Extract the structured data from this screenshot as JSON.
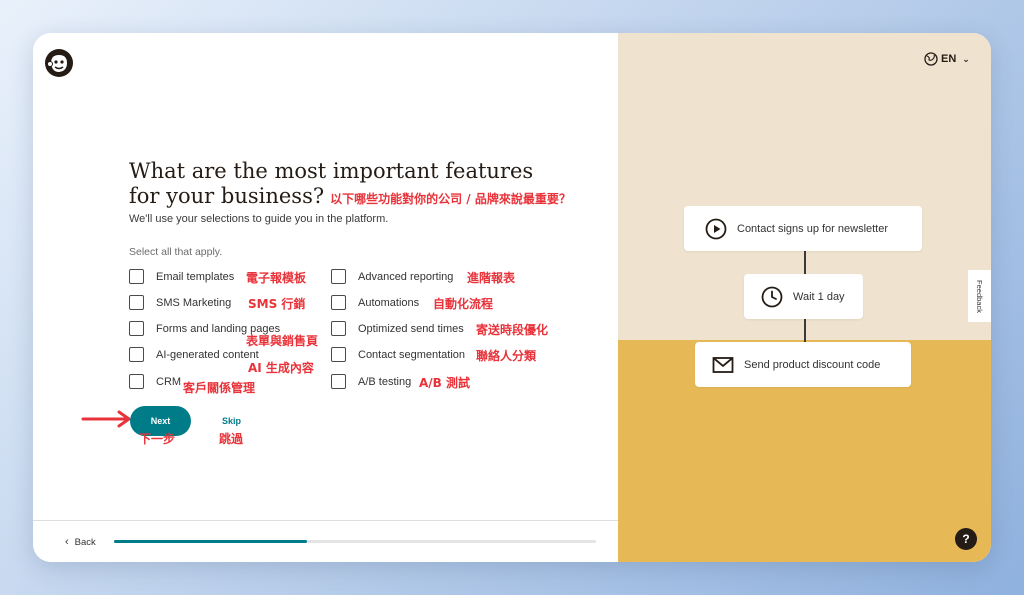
{
  "header": {
    "language": "EN"
  },
  "main": {
    "title_line1": "What are the most important features",
    "title_line2": "for your business?",
    "title_annotation": "以下哪些功能對你的公司 / 品牌來說最重要？",
    "subtitle": "We'll use your selections to guide you in the platform.",
    "select_all": "Select all that apply.",
    "options": [
      {
        "label": "Email templates",
        "note": "電子報模板",
        "checked": false
      },
      {
        "label": "SMS Marketing",
        "note": "SMS 行銷",
        "checked": false
      },
      {
        "label": "Forms and landing pages",
        "note": "表單與銷售頁",
        "checked": false
      },
      {
        "label": "AI-generated content",
        "note": "AI 生成內容",
        "checked": false
      },
      {
        "label": "CRM",
        "note": "客戶關係管理",
        "checked": false
      },
      {
        "label": "Advanced reporting",
        "note": "進階報表",
        "checked": false
      },
      {
        "label": "Automations",
        "note": "自動化流程",
        "checked": false
      },
      {
        "label": "Optimized send times",
        "note": "寄送時段優化",
        "checked": false
      },
      {
        "label": "Contact segmentation",
        "note": "聯絡人分類",
        "checked": false
      },
      {
        "label": "A/B testing",
        "note": "A/B 測試",
        "checked": false
      }
    ],
    "next_label": "Next",
    "next_note": "下一步",
    "skip_label": "Skip",
    "skip_note": "跳過"
  },
  "footer": {
    "back_label": "Back",
    "progress": 0.4
  },
  "flow": {
    "step1": "Contact signs up for newsletter",
    "step2": "Wait 1 day",
    "step3": "Send product discount code"
  },
  "sidebar": {
    "feedback_label": "Feedback",
    "help_label": "?"
  },
  "colors": {
    "accent": "#007c89",
    "annotation": "#e8333a",
    "panel_top": "#efe3cf",
    "panel_bottom": "#e6b956",
    "text": "#241c15"
  }
}
